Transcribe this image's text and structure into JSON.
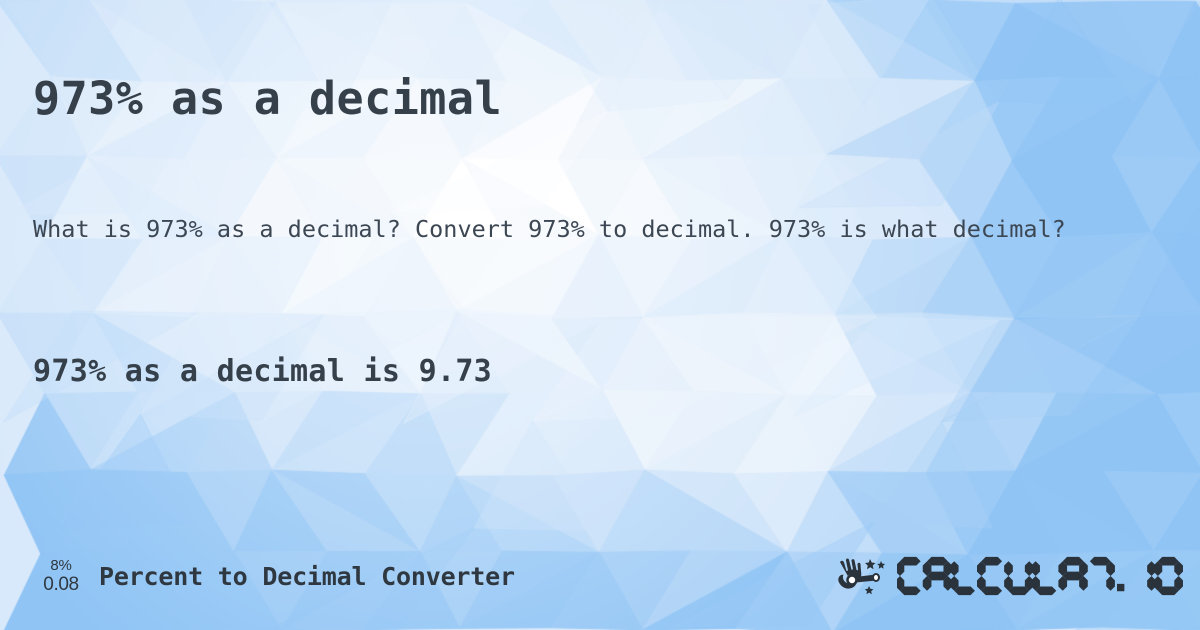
{
  "page": {
    "title": "973% as a decimal",
    "question": "What is 973% as a decimal? Convert 973% to decimal. 973% is what decimal?",
    "answer": "973% as a decimal is 9.73"
  },
  "values": {
    "percent": "973%",
    "decimal": "9.73"
  },
  "footer": {
    "icon_top": "8%",
    "icon_bottom": "0.08",
    "label": "Percent to Decimal Converter",
    "brand": "CALCULAT.IO",
    "brand_icon": "hand-magic-wand-icon"
  },
  "colors": {
    "heading_text": "#36404b",
    "body_text": "#3c4753",
    "footer_text": "#2f3840",
    "brand": "#2a333c",
    "bg_light": "#ffffff",
    "bg_mid": "#d8e9fb",
    "bg_dark": "#8fc4f5"
  }
}
